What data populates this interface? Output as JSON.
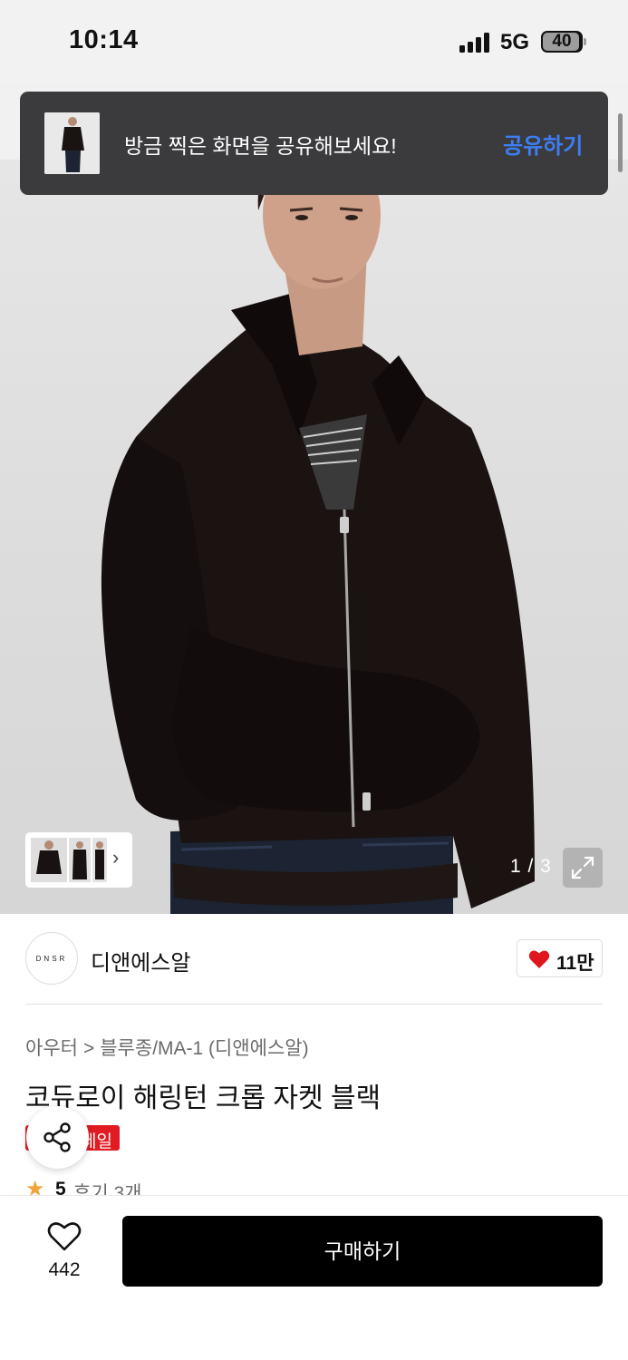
{
  "status_bar": {
    "time": "10:14",
    "network": "5G",
    "battery": "40"
  },
  "toast": {
    "message": "방금 찍은 화면을 공유해보세요!",
    "action_label": "공유하기"
  },
  "gallery": {
    "current": "1 / 3",
    "thumbnail_count": 3
  },
  "brand": {
    "logo_text": "DNSR",
    "name": "디앤에스알",
    "like_count": "11만"
  },
  "product": {
    "breadcrumb": [
      "아우터",
      "블루종/MA-1 (디앤에스알)"
    ],
    "breadcrumb_separator": ">",
    "title": "코듀로이 해링턴 크롭 자켓 블랙",
    "badge": "세일",
    "rating_score": "5",
    "reviews": "후기 3개"
  },
  "bottom_bar": {
    "wish_count": "442",
    "buy_label": "구매하기"
  },
  "colors": {
    "accent_blue": "#3d7ef5",
    "sale_red": "#e01b22",
    "heart_red": "#e0161e",
    "star": "#f2a33a"
  }
}
